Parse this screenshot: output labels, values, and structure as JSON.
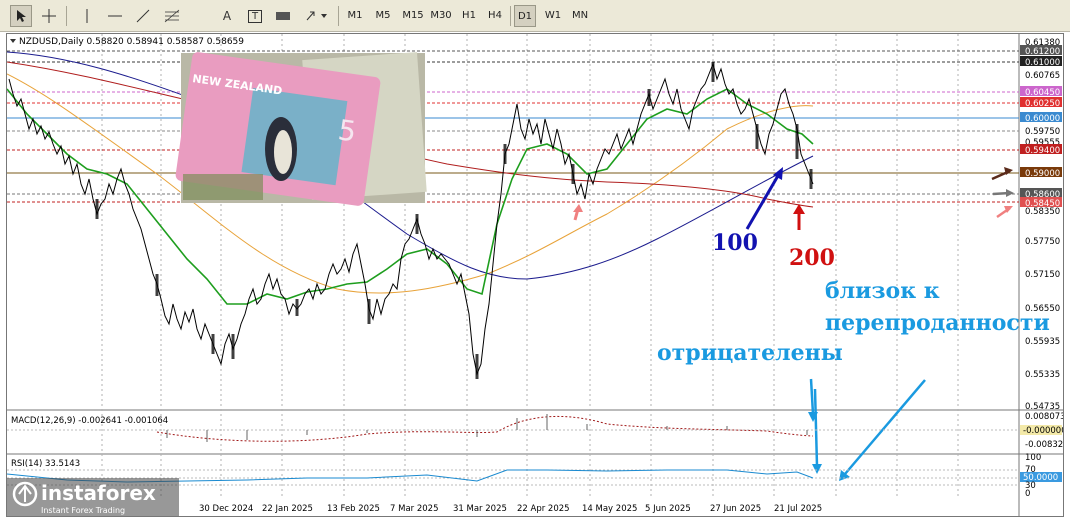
{
  "toolbar": {
    "tools": [
      {
        "icon": "cursor-icon"
      },
      {
        "icon": "crosshair-icon"
      },
      {
        "icon": "vertical-line-icon"
      },
      {
        "icon": "horizontal-line-icon"
      },
      {
        "icon": "trendline-icon"
      },
      {
        "icon": "fibonacci-icon"
      },
      {
        "icon": "text-tool-icon",
        "label": "A"
      },
      {
        "icon": "text-label-icon",
        "label": "T"
      },
      {
        "icon": "rectangle-icon"
      },
      {
        "icon": "arrows-icon"
      }
    ],
    "timeframes": [
      "M1",
      "M5",
      "M15",
      "M30",
      "H1",
      "H4",
      "D1",
      "W1",
      "MN"
    ]
  },
  "chart": {
    "header": "NZDUSD,Daily  0.58820 0.58941 0.58587 0.58659",
    "price_axis": [
      "0.61380",
      "0.61200",
      "0.61000",
      "0.60765",
      "0.60450",
      "0.60250",
      "0.60000",
      "0.59750",
      "0.59555",
      "0.59400",
      "0.59000",
      "0.58600",
      "0.58450",
      "0.58350",
      "0.57750",
      "0.57150",
      "0.56550",
      "0.55935",
      "0.55335",
      "0.54735"
    ],
    "dates": [
      "30 Dec 2024",
      "22 Jan 2025",
      "13 Feb 2025",
      "7 Mar 2025",
      "31 Mar 2025",
      "22 Apr 2025",
      "14 May 2025",
      "5 Jun 2025",
      "27 Jun 2025",
      "21 Jul 2025"
    ],
    "annotations": {
      "ma100": "100",
      "ma200": "200",
      "oversold": "близок к\nперепроданности",
      "negative": "отрицателены"
    },
    "macd": {
      "label": "MACD(12,26,9) -0.002641 -0.001064",
      "axis": [
        "0.008073",
        "-0.000000",
        "-0.008321"
      ]
    },
    "rsi": {
      "label": "RSI(14) 33.5143",
      "axis": [
        "100",
        "70",
        "50.0000",
        "30",
        "0"
      ]
    },
    "watermark": {
      "brand": "instaforex",
      "tagline": "Instant Forex Trading"
    }
  },
  "colors": {
    "candles": "#000000",
    "ma_green": "#1e9e1e",
    "ma_blue": "#1c1c8e",
    "ma_red": "#b01e1e",
    "ma_orange": "#e8a33a",
    "annotation_blue": "#1a9ae0",
    "annotation_navy": "#1212b0",
    "annotation_red": "#d01010"
  }
}
